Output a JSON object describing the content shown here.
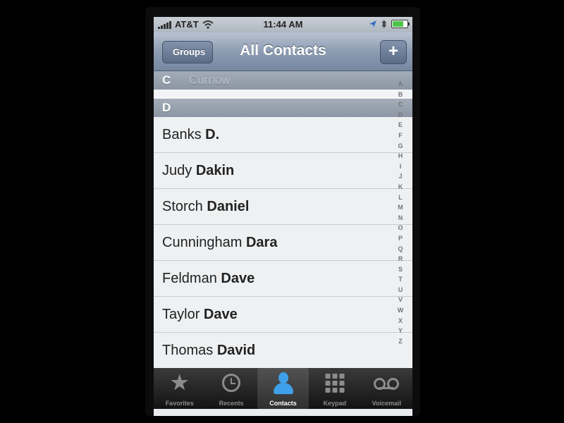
{
  "status_bar": {
    "carrier": "AT&T",
    "time": "11:44 AM",
    "battery_level": 0.85
  },
  "nav": {
    "back_label": "Groups",
    "title": "All Contacts",
    "add_label": "+"
  },
  "sections": [
    {
      "letter": "C",
      "ghost_text": "Curnow"
    },
    {
      "letter": "D"
    }
  ],
  "contacts": [
    {
      "first": "Banks",
      "last": "D."
    },
    {
      "first": "Judy",
      "last": "Dakin"
    },
    {
      "first": "Storch",
      "last": "Daniel"
    },
    {
      "first": "Cunningham",
      "last": "Dara"
    },
    {
      "first": "Feldman",
      "last": "Dave"
    },
    {
      "first": "Taylor",
      "last": "Dave"
    },
    {
      "first": "Thomas",
      "last": "David"
    }
  ],
  "index_letters": [
    "A",
    "B",
    "C",
    "D",
    "E",
    "F",
    "G",
    "H",
    "I",
    "J",
    "K",
    "L",
    "M",
    "N",
    "O",
    "P",
    "Q",
    "R",
    "S",
    "T",
    "U",
    "V",
    "W",
    "X",
    "Y",
    "Z"
  ],
  "tabs": [
    {
      "label": "Favorites",
      "icon": "star-icon"
    },
    {
      "label": "Recents",
      "icon": "clock-icon"
    },
    {
      "label": "Contacts",
      "icon": "person-icon",
      "active": true
    },
    {
      "label": "Keypad",
      "icon": "keypad-icon"
    },
    {
      "label": "Voicemail",
      "icon": "voicemail-icon"
    }
  ],
  "colors": {
    "nav_bar": "#8d9cb2",
    "section_header": "#a3acb8",
    "active_tab_icon": "#3ea0e8",
    "battery_fill": "#4cc44a"
  }
}
